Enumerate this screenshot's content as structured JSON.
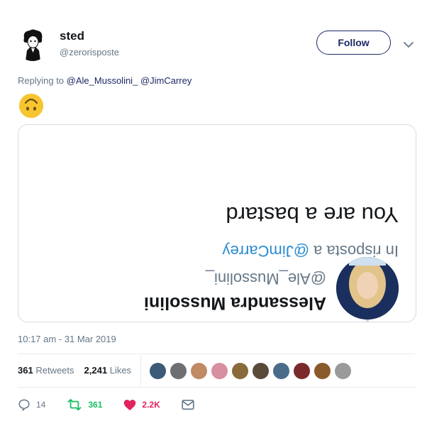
{
  "tweet": {
    "display_name": "sted",
    "handle": "@zerorisposte",
    "follow_label": "Follow",
    "replying_prefix": "Replying to",
    "replying_to": [
      "@Ale_Mussolini_",
      "@JimCarrey"
    ],
    "timestamp": "10:17 am - 31 Mar 2019"
  },
  "embedded": {
    "name": "Alessandra Mussolini",
    "handle": "@Ale_Mussolini_",
    "reply_prefix": "In risposta a",
    "reply_mention": "@JimCarrey",
    "text": "You are a bastard"
  },
  "stats": {
    "retweets_count": "361",
    "retweets_label": "Retweets",
    "likes_count": "2,241",
    "likes_label": "Likes"
  },
  "likers": [
    {
      "color": "#3b5b78"
    },
    {
      "color": "#6d6f73"
    },
    {
      "color": "#c08a63"
    },
    {
      "color": "#d88fa0"
    },
    {
      "color": "#8a6a3a"
    },
    {
      "color": "#5a4a3a"
    },
    {
      "color": "#4a6b8a"
    },
    {
      "color": "#7a2a2a"
    },
    {
      "color": "#8b5a2b"
    },
    {
      "color": "#9a9a9a"
    }
  ],
  "actions": {
    "reply_count": "14",
    "retweet_count": "361",
    "like_count": "2.2K"
  },
  "colors": {
    "accent": "#1c2866",
    "retweet": "#17bf63",
    "like": "#e0245e",
    "muted": "#657786"
  }
}
